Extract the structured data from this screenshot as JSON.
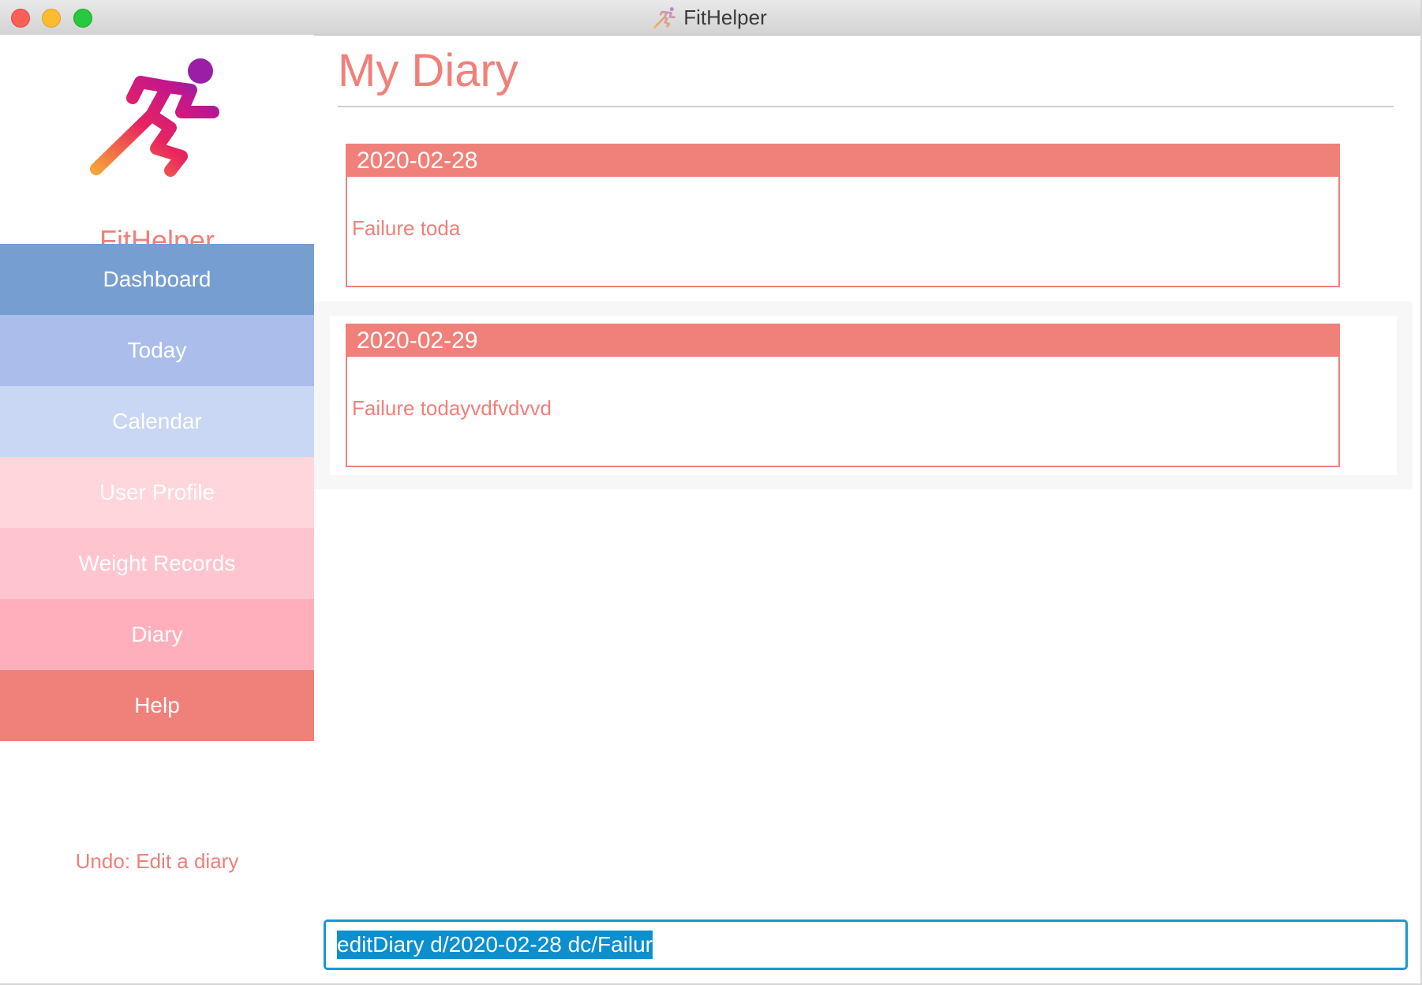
{
  "window": {
    "title": "FitHelper"
  },
  "sidebar": {
    "app_name": "FitHelper",
    "items": [
      {
        "label": "Dashboard",
        "color": "#779ed1"
      },
      {
        "label": "Today",
        "color": "#abbdea"
      },
      {
        "label": "Calendar",
        "color": "#c9d6f4"
      },
      {
        "label": "User Profile",
        "color": "#ffd6dc"
      },
      {
        "label": "Weight Records",
        "color": "#ffc5cf"
      },
      {
        "label": "Diary",
        "color": "#ffafbc"
      },
      {
        "label": "Help",
        "color": "#f0807a"
      }
    ],
    "status": "Undo: Edit a diary"
  },
  "main": {
    "title": "My Diary",
    "diaries": [
      {
        "date": "2020-02-28",
        "content": "Failure toda"
      },
      {
        "date": "2020-02-29",
        "content": "Failure todayvdfvdvvd"
      }
    ]
  },
  "command": {
    "value": "editDiary d/2020-02-28 dc/Failur"
  },
  "colors": {
    "accent": "#f0807a",
    "command_highlight": "#0a8fcf"
  }
}
